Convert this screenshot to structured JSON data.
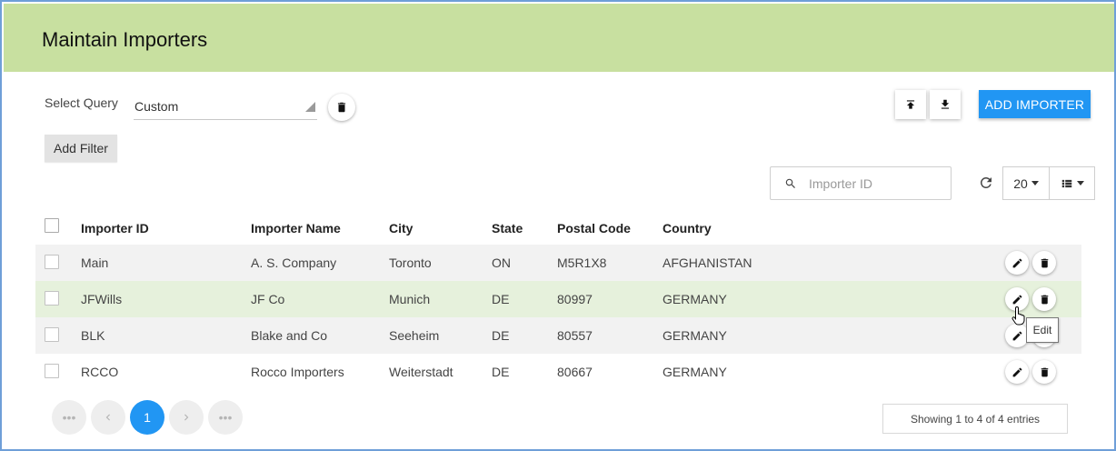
{
  "header": {
    "title": "Maintain Importers"
  },
  "query": {
    "label": "Select Query",
    "selected": "Custom"
  },
  "filter": {
    "add_label": "Add Filter"
  },
  "toolbar": {
    "add_importer_label": "ADD IMPORTER",
    "upload_icon": "upload-icon",
    "download_icon": "download-icon"
  },
  "search": {
    "placeholder": "Importer ID",
    "value": ""
  },
  "pagesize": {
    "value": "20"
  },
  "table": {
    "columns": [
      "Importer ID",
      "Importer Name",
      "City",
      "State",
      "Postal Code",
      "Country"
    ],
    "rows": [
      {
        "id": "Main",
        "name": "A. S. Company",
        "city": "Toronto",
        "state": "ON",
        "postal": "M5R1X8",
        "country": "AFGHANISTAN"
      },
      {
        "id": "JFWills",
        "name": "JF Co",
        "city": "Munich",
        "state": "DE",
        "postal": "80997",
        "country": "GERMANY"
      },
      {
        "id": "BLK",
        "name": "Blake and Co",
        "city": "Seeheim",
        "state": "DE",
        "postal": "80557",
        "country": "GERMANY"
      },
      {
        "id": "RCCO",
        "name": "Rocco Importers",
        "city": "Weiterstadt",
        "state": "DE",
        "postal": "80667",
        "country": "GERMANY"
      }
    ]
  },
  "tooltip": {
    "text": "Edit"
  },
  "pagination": {
    "current": "1",
    "first": "•••",
    "last": "•••"
  },
  "footer": {
    "showing": "Showing 1 to 4 of 4 entries"
  },
  "colors": {
    "header_bg": "#c8e0a0",
    "accent": "#2196f3",
    "row_alt": "#f2f2f2",
    "row_hover": "#e6f1dc"
  }
}
